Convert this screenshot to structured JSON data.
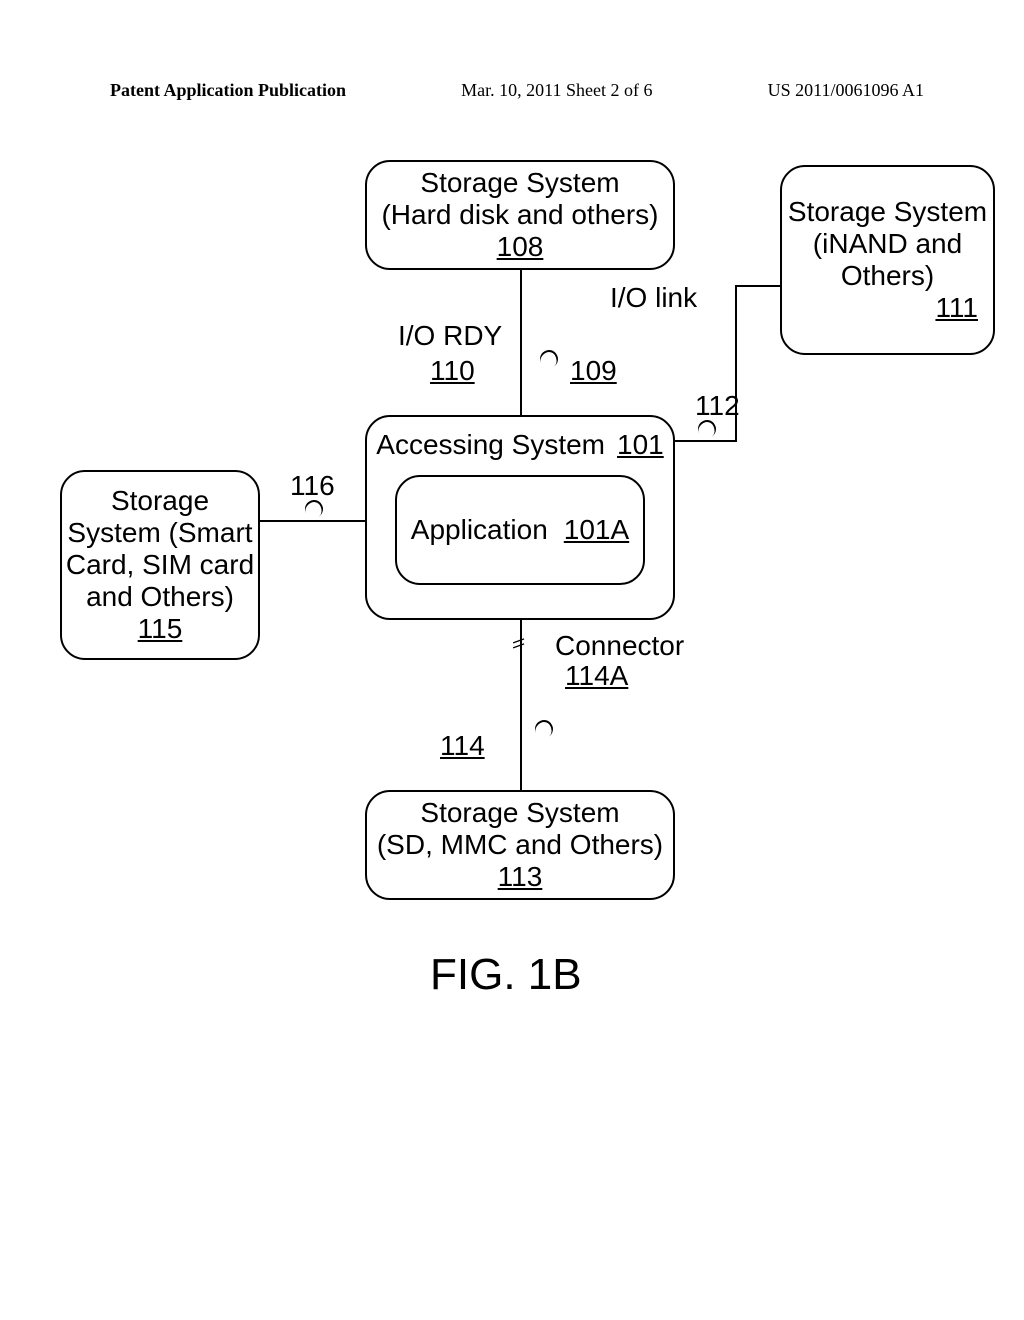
{
  "header": {
    "left": "Patent Application Publication",
    "center": "Mar. 10, 2011  Sheet 2 of 6",
    "right": "US 2011/0061096 A1"
  },
  "diagram": {
    "top_box": {
      "line1": "Storage System",
      "line2": "(Hard disk and others)",
      "ref": "108"
    },
    "io_link": "I/O link",
    "io_rdy": "I/O RDY",
    "ref_109": "109",
    "ref_110": "110",
    "ref_112": "112",
    "accessing_system": "Accessing System",
    "ref_101": "101",
    "application": "Application",
    "ref_101a": "101A",
    "right_box": {
      "line1": "Storage System",
      "line2": "(iNAND and",
      "line3": "Others)",
      "ref": "111"
    },
    "ref_116": "116",
    "connector": "Connector",
    "ref_114a": "114A",
    "ref_114": "114",
    "left_box": {
      "line1": "Storage",
      "line2": "System (Smart",
      "line3": "Card, SIM card",
      "line4": "and Others)",
      "ref": "115"
    },
    "bottom_box": {
      "line1": "Storage System",
      "line2": "(SD, MMC and Others)",
      "ref": "113"
    },
    "fig_label": "FIG. 1B"
  }
}
